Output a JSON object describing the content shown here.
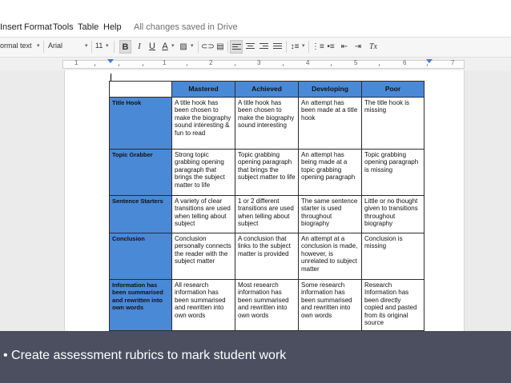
{
  "menubar": {
    "items": [
      "Insert",
      "Format",
      "Tools",
      "Table",
      "Help"
    ],
    "save_status": "All changes saved in Drive"
  },
  "toolbar": {
    "style": "ormal text",
    "font": "Arial",
    "size": "11",
    "bold": "B",
    "italic": "I",
    "underline": "U",
    "text_color": "A",
    "clear_format": "Tx"
  },
  "ruler": {
    "numbers": [
      "1",
      "1",
      "2",
      "3",
      "4",
      "5",
      "6",
      "7"
    ]
  },
  "rubric": {
    "headers": [
      "Mastered",
      "Achieved",
      "Developing",
      "Poor"
    ],
    "rows": [
      {
        "label": "Title Hook",
        "cells": [
          "A title hook has been chosen to make the biography sound interesting & fun to read",
          "A title hook has been chosen to make the biography sound interesting",
          "An attempt has been made at a title hook",
          "The title hook is missing"
        ]
      },
      {
        "label": "Topic Grabber",
        "cells": [
          "Strong topic grabbing opening paragraph that brings the subject matter to life",
          "Topic grabbing opening paragraph that brings the subject matter to life",
          "An attempt has being made at a topic grabbing opening paragraph",
          "Topic grabbing opening paragraph is missing"
        ]
      },
      {
        "label": "Sentence Starters",
        "cells": [
          "A variety of clear transitions are used when telling about subject",
          "1 or 2 different transitions are used when telling about subject",
          "The same sentence starter is used throughout biography",
          "Little or no thought given to transitions throughout biography"
        ]
      },
      {
        "label": "Conclusion",
        "cells": [
          "Conclusion personally connects the reader with the subject matter",
          "A conclusion that links to the subject matter is provided",
          "An attempt at a conclusion is made, however, is unrelated to subject matter",
          "Conclusion is missing"
        ]
      },
      {
        "label": "Information has been summarised and rewritten into own words",
        "cells": [
          "All research information has been summarised and rewritten into own words",
          "Most research information has been summarised and rewritten into own words",
          "Some research information has been summarised and rewritten into own words",
          "Research Information has been directly copied and pasted from its original source"
        ]
      }
    ]
  },
  "caption": "• Create assessment rubrics to mark student work",
  "colors": {
    "header_blue": "#4a89d6",
    "banner": "#45495b",
    "ruler_marker": "#4a76c7"
  }
}
